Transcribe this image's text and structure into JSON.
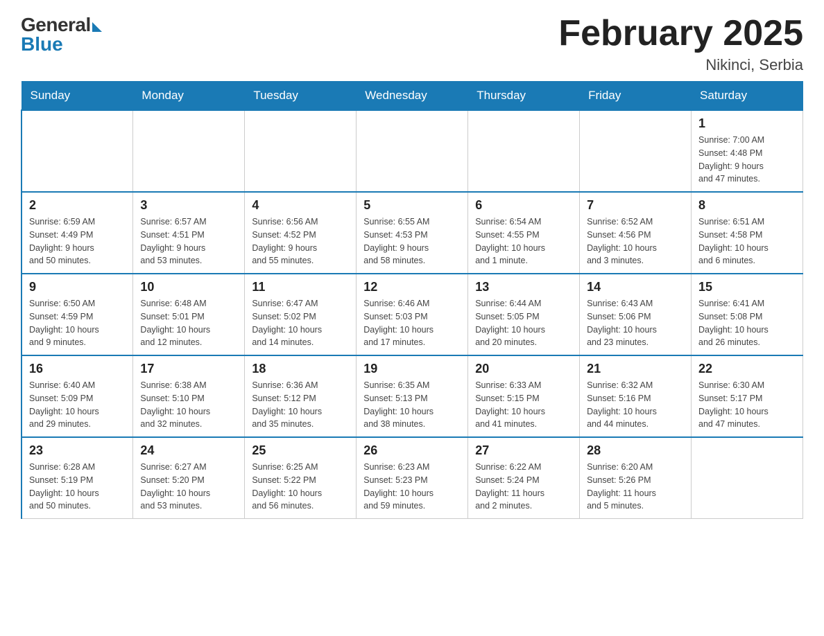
{
  "logo": {
    "general": "General",
    "blue": "Blue"
  },
  "title": {
    "month_year": "February 2025",
    "location": "Nikinci, Serbia"
  },
  "weekdays": [
    "Sunday",
    "Monday",
    "Tuesday",
    "Wednesday",
    "Thursday",
    "Friday",
    "Saturday"
  ],
  "weeks": [
    [
      {
        "day": "",
        "info": ""
      },
      {
        "day": "",
        "info": ""
      },
      {
        "day": "",
        "info": ""
      },
      {
        "day": "",
        "info": ""
      },
      {
        "day": "",
        "info": ""
      },
      {
        "day": "",
        "info": ""
      },
      {
        "day": "1",
        "info": "Sunrise: 7:00 AM\nSunset: 4:48 PM\nDaylight: 9 hours\nand 47 minutes."
      }
    ],
    [
      {
        "day": "2",
        "info": "Sunrise: 6:59 AM\nSunset: 4:49 PM\nDaylight: 9 hours\nand 50 minutes."
      },
      {
        "day": "3",
        "info": "Sunrise: 6:57 AM\nSunset: 4:51 PM\nDaylight: 9 hours\nand 53 minutes."
      },
      {
        "day": "4",
        "info": "Sunrise: 6:56 AM\nSunset: 4:52 PM\nDaylight: 9 hours\nand 55 minutes."
      },
      {
        "day": "5",
        "info": "Sunrise: 6:55 AM\nSunset: 4:53 PM\nDaylight: 9 hours\nand 58 minutes."
      },
      {
        "day": "6",
        "info": "Sunrise: 6:54 AM\nSunset: 4:55 PM\nDaylight: 10 hours\nand 1 minute."
      },
      {
        "day": "7",
        "info": "Sunrise: 6:52 AM\nSunset: 4:56 PM\nDaylight: 10 hours\nand 3 minutes."
      },
      {
        "day": "8",
        "info": "Sunrise: 6:51 AM\nSunset: 4:58 PM\nDaylight: 10 hours\nand 6 minutes."
      }
    ],
    [
      {
        "day": "9",
        "info": "Sunrise: 6:50 AM\nSunset: 4:59 PM\nDaylight: 10 hours\nand 9 minutes."
      },
      {
        "day": "10",
        "info": "Sunrise: 6:48 AM\nSunset: 5:01 PM\nDaylight: 10 hours\nand 12 minutes."
      },
      {
        "day": "11",
        "info": "Sunrise: 6:47 AM\nSunset: 5:02 PM\nDaylight: 10 hours\nand 14 minutes."
      },
      {
        "day": "12",
        "info": "Sunrise: 6:46 AM\nSunset: 5:03 PM\nDaylight: 10 hours\nand 17 minutes."
      },
      {
        "day": "13",
        "info": "Sunrise: 6:44 AM\nSunset: 5:05 PM\nDaylight: 10 hours\nand 20 minutes."
      },
      {
        "day": "14",
        "info": "Sunrise: 6:43 AM\nSunset: 5:06 PM\nDaylight: 10 hours\nand 23 minutes."
      },
      {
        "day": "15",
        "info": "Sunrise: 6:41 AM\nSunset: 5:08 PM\nDaylight: 10 hours\nand 26 minutes."
      }
    ],
    [
      {
        "day": "16",
        "info": "Sunrise: 6:40 AM\nSunset: 5:09 PM\nDaylight: 10 hours\nand 29 minutes."
      },
      {
        "day": "17",
        "info": "Sunrise: 6:38 AM\nSunset: 5:10 PM\nDaylight: 10 hours\nand 32 minutes."
      },
      {
        "day": "18",
        "info": "Sunrise: 6:36 AM\nSunset: 5:12 PM\nDaylight: 10 hours\nand 35 minutes."
      },
      {
        "day": "19",
        "info": "Sunrise: 6:35 AM\nSunset: 5:13 PM\nDaylight: 10 hours\nand 38 minutes."
      },
      {
        "day": "20",
        "info": "Sunrise: 6:33 AM\nSunset: 5:15 PM\nDaylight: 10 hours\nand 41 minutes."
      },
      {
        "day": "21",
        "info": "Sunrise: 6:32 AM\nSunset: 5:16 PM\nDaylight: 10 hours\nand 44 minutes."
      },
      {
        "day": "22",
        "info": "Sunrise: 6:30 AM\nSunset: 5:17 PM\nDaylight: 10 hours\nand 47 minutes."
      }
    ],
    [
      {
        "day": "23",
        "info": "Sunrise: 6:28 AM\nSunset: 5:19 PM\nDaylight: 10 hours\nand 50 minutes."
      },
      {
        "day": "24",
        "info": "Sunrise: 6:27 AM\nSunset: 5:20 PM\nDaylight: 10 hours\nand 53 minutes."
      },
      {
        "day": "25",
        "info": "Sunrise: 6:25 AM\nSunset: 5:22 PM\nDaylight: 10 hours\nand 56 minutes."
      },
      {
        "day": "26",
        "info": "Sunrise: 6:23 AM\nSunset: 5:23 PM\nDaylight: 10 hours\nand 59 minutes."
      },
      {
        "day": "27",
        "info": "Sunrise: 6:22 AM\nSunset: 5:24 PM\nDaylight: 11 hours\nand 2 minutes."
      },
      {
        "day": "28",
        "info": "Sunrise: 6:20 AM\nSunset: 5:26 PM\nDaylight: 11 hours\nand 5 minutes."
      },
      {
        "day": "",
        "info": ""
      }
    ]
  ]
}
